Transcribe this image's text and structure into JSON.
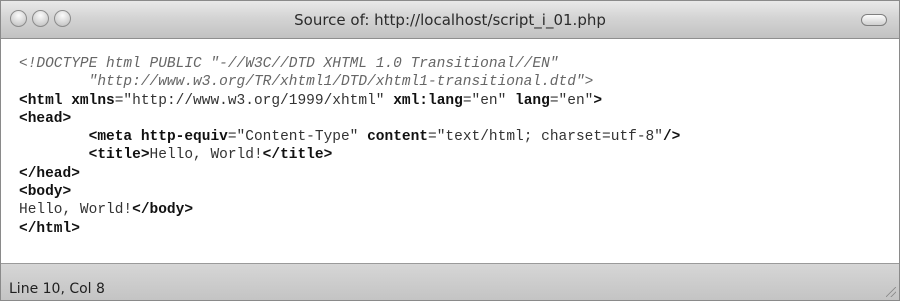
{
  "window": {
    "title": "Source of: http://localhost/script_i_01.php",
    "controls": [
      "close-button",
      "minimize-button",
      "zoom-button",
      "toolbar-toggle"
    ]
  },
  "source": {
    "lines": [
      [
        {
          "t": "<!DOCTYPE html PUBLIC \"-//W3C//DTD XHTML 1.0 Transitional//EN\"",
          "s": "c"
        }
      ],
      [
        {
          "t": "        \"http://www.w3.org/TR/xhtml1/DTD/xhtml1-transitional.dtd\">",
          "s": "c"
        }
      ],
      [
        {
          "t": "<html",
          "s": "b"
        },
        {
          "t": " ",
          "s": "v"
        },
        {
          "t": "xmlns",
          "s": "b"
        },
        {
          "t": "=\"http://www.w3.org/1999/xhtml\" ",
          "s": "v"
        },
        {
          "t": "xml:lang",
          "s": "b"
        },
        {
          "t": "=\"en\" ",
          "s": "v"
        },
        {
          "t": "lang",
          "s": "b"
        },
        {
          "t": "=\"en\"",
          "s": "v"
        },
        {
          "t": ">",
          "s": "b"
        }
      ],
      [
        {
          "t": "<head>",
          "s": "b"
        }
      ],
      [
        {
          "t": "        ",
          "s": "v"
        },
        {
          "t": "<meta",
          "s": "b"
        },
        {
          "t": " ",
          "s": "v"
        },
        {
          "t": "http-equiv",
          "s": "b"
        },
        {
          "t": "=\"Content-Type\" ",
          "s": "v"
        },
        {
          "t": "content",
          "s": "b"
        },
        {
          "t": "=\"text/html; charset=utf-8\"",
          "s": "v"
        },
        {
          "t": "/>",
          "s": "b"
        }
      ],
      [
        {
          "t": "        ",
          "s": "v"
        },
        {
          "t": "<title>",
          "s": "b"
        },
        {
          "t": "Hello, World!",
          "s": "v"
        },
        {
          "t": "</title>",
          "s": "b"
        }
      ],
      [
        {
          "t": "</head>",
          "s": "b"
        }
      ],
      [
        {
          "t": "<body>",
          "s": "b"
        }
      ],
      [
        {
          "t": "Hello, World!",
          "s": "v"
        },
        {
          "t": "</body>",
          "s": "b"
        }
      ],
      [
        {
          "t": "</html>",
          "s": "b"
        }
      ]
    ]
  },
  "statusbar": {
    "position": "Line 10, Col 8"
  }
}
